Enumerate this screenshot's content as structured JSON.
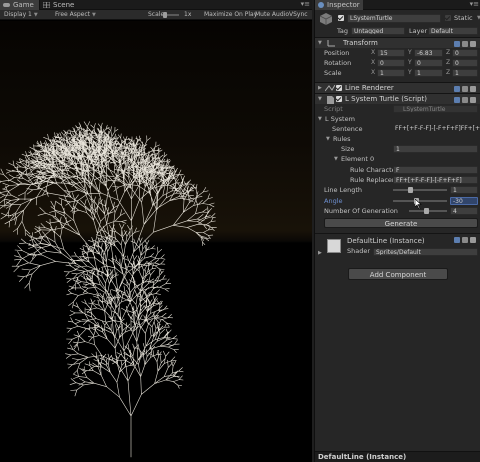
{
  "game_tab": {
    "label": "Game"
  },
  "scene_tab": {
    "label": "Scene"
  },
  "toolbar": {
    "display": "Display 1",
    "aspect": "Free Aspect",
    "scale_label": "Scale",
    "scale_value": "1x",
    "maximize": "Maximize On Play",
    "mute": "Mute Audio",
    "vsync": "VSync"
  },
  "inspector": {
    "tab_label": "Inspector",
    "object_name": "LSystemTurtle",
    "static_label": "Static",
    "tag_label": "Tag",
    "tag_value": "Untagged",
    "layer_label": "Layer",
    "layer_value": "Default"
  },
  "transform": {
    "header": "Transform",
    "position_label": "Position",
    "rotation_label": "Rotation",
    "scale_label": "Scale",
    "axes": [
      "X",
      "Y",
      "Z"
    ],
    "position": [
      "15",
      "-6.83",
      "0"
    ],
    "rotation": [
      "0",
      "0",
      "0"
    ],
    "scale": [
      "1",
      "1",
      "1"
    ]
  },
  "line_renderer": {
    "header": "Line Renderer"
  },
  "lsystem_script": {
    "header": "L System Turtle (Script)",
    "script_label": "Script",
    "script_value": "LSystemTurtle",
    "lsystem_label": "L System",
    "sentence_label": "Sentence",
    "sentence_value": "FF+[+F-F-F]-[-F+F+F]FF+[+F-F-F]-[-F+F",
    "rules_label": "Rules",
    "size_label": "Size",
    "size_value": "1",
    "element0_label": "Element 0",
    "rule_char_label": "Rule Characte",
    "rule_char_value": "F",
    "rule_replace_label": "Rule Replacen",
    "rule_replace_value": "FF+[+F-F-F]-[-F+F+F]",
    "line_length_label": "Line Length",
    "line_length_value": "1",
    "line_length_level": 0.3,
    "angle_label": "Angle",
    "angle_value": "-30",
    "angle_level": 0.42,
    "generations_label": "Number Of Generation",
    "generations_value": "4",
    "generations_level": 0.45,
    "generate_button": "Generate"
  },
  "material": {
    "name": "DefaultLine (Instance)",
    "shader_label": "Shader",
    "shader_value": "Sprites/Default"
  },
  "add_component_button": "Add Component",
  "status_bar": "DefaultLine (Instance)",
  "colors": {
    "editor_bg": "#262626",
    "tree_stroke": "#e6e2d8",
    "highlight_field": "#31456b"
  }
}
